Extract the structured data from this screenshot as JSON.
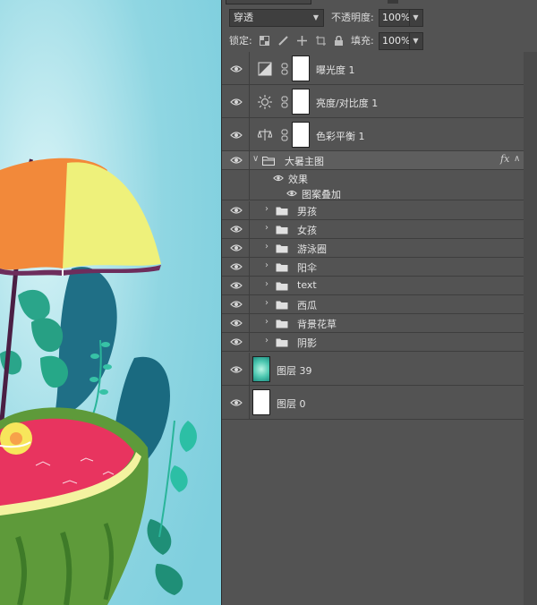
{
  "panel": {
    "blend_mode": "穿透",
    "opacity_label": "不透明度:",
    "opacity_value": "100%",
    "lock_label": "锁定:",
    "fill_label": "填充:",
    "fill_value": "100%"
  },
  "layers": [
    {
      "name": "曝光度 1",
      "kind": "adjustment",
      "icon": "exposure-icon"
    },
    {
      "name": "亮度/对比度 1",
      "kind": "adjustment",
      "icon": "brightness-icon"
    },
    {
      "name": "色彩平衡 1",
      "kind": "adjustment",
      "icon": "color-balance-icon"
    },
    {
      "name": "大暑主图",
      "kind": "group-open",
      "fx": "fx"
    },
    {
      "name": "效果",
      "kind": "effects"
    },
    {
      "name": "图案叠加",
      "kind": "effect-item"
    },
    {
      "name": "男孩",
      "kind": "group"
    },
    {
      "name": "女孩",
      "kind": "group"
    },
    {
      "name": "游泳圈",
      "kind": "group"
    },
    {
      "name": "阳伞",
      "kind": "group"
    },
    {
      "name": "text",
      "kind": "group"
    },
    {
      "name": "西瓜",
      "kind": "group"
    },
    {
      "name": "背景花草",
      "kind": "group"
    },
    {
      "name": "阴影",
      "kind": "group"
    },
    {
      "name": "图层 39",
      "kind": "pixel-gradient"
    },
    {
      "name": "图层 0",
      "kind": "pixel-white"
    }
  ],
  "colors": {
    "panel_bg": "#535353",
    "canvas_bg": "#8fd6e2",
    "umbrella_orange": "#f2893a",
    "umbrella_yellow": "#f0f07a",
    "watermelon_flesh": "#e8345f",
    "watermelon_rind": "#5e9a3a"
  }
}
